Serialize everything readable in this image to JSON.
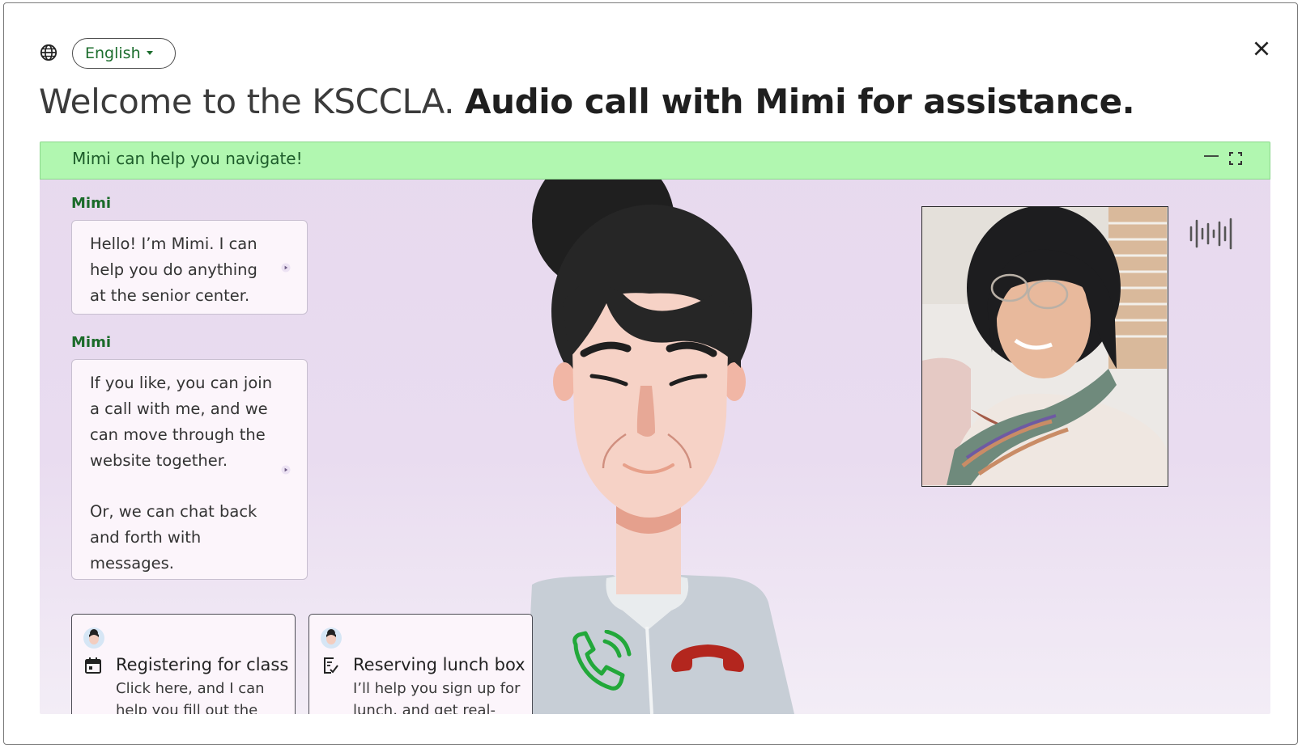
{
  "header": {
    "language_selected": "English",
    "title_light": "Welcome to the KSCCLA.",
    "title_bold": "Audio call with Mimi for assistance."
  },
  "banner": {
    "text": "Mimi can help you navigate!"
  },
  "messages": [
    {
      "speaker": "Mimi",
      "paragraphs": [
        "Hello! I’m Mimi. I can help you do anything at the senior center."
      ]
    },
    {
      "speaker": "Mimi",
      "paragraphs": [
        "If you like, you can join a call with me, and we can move through the website together.",
        "Or, we can chat back and forth with messages."
      ]
    }
  ],
  "cards": [
    {
      "icon": "calendar-icon",
      "title": "Registering for class",
      "desc": "Click here, and I can help you fill out the"
    },
    {
      "icon": "checklist-icon",
      "title": "Reserving lunch box",
      "desc": "I’ll help you sign up for lunch, and get real-time"
    }
  ],
  "colors": {
    "accent_green": "#1d6e2e",
    "banner_bg": "#b1f7b0",
    "panel_bg": "#e7d9ee",
    "call_green": "#22a83a",
    "call_red": "#b3261e"
  }
}
